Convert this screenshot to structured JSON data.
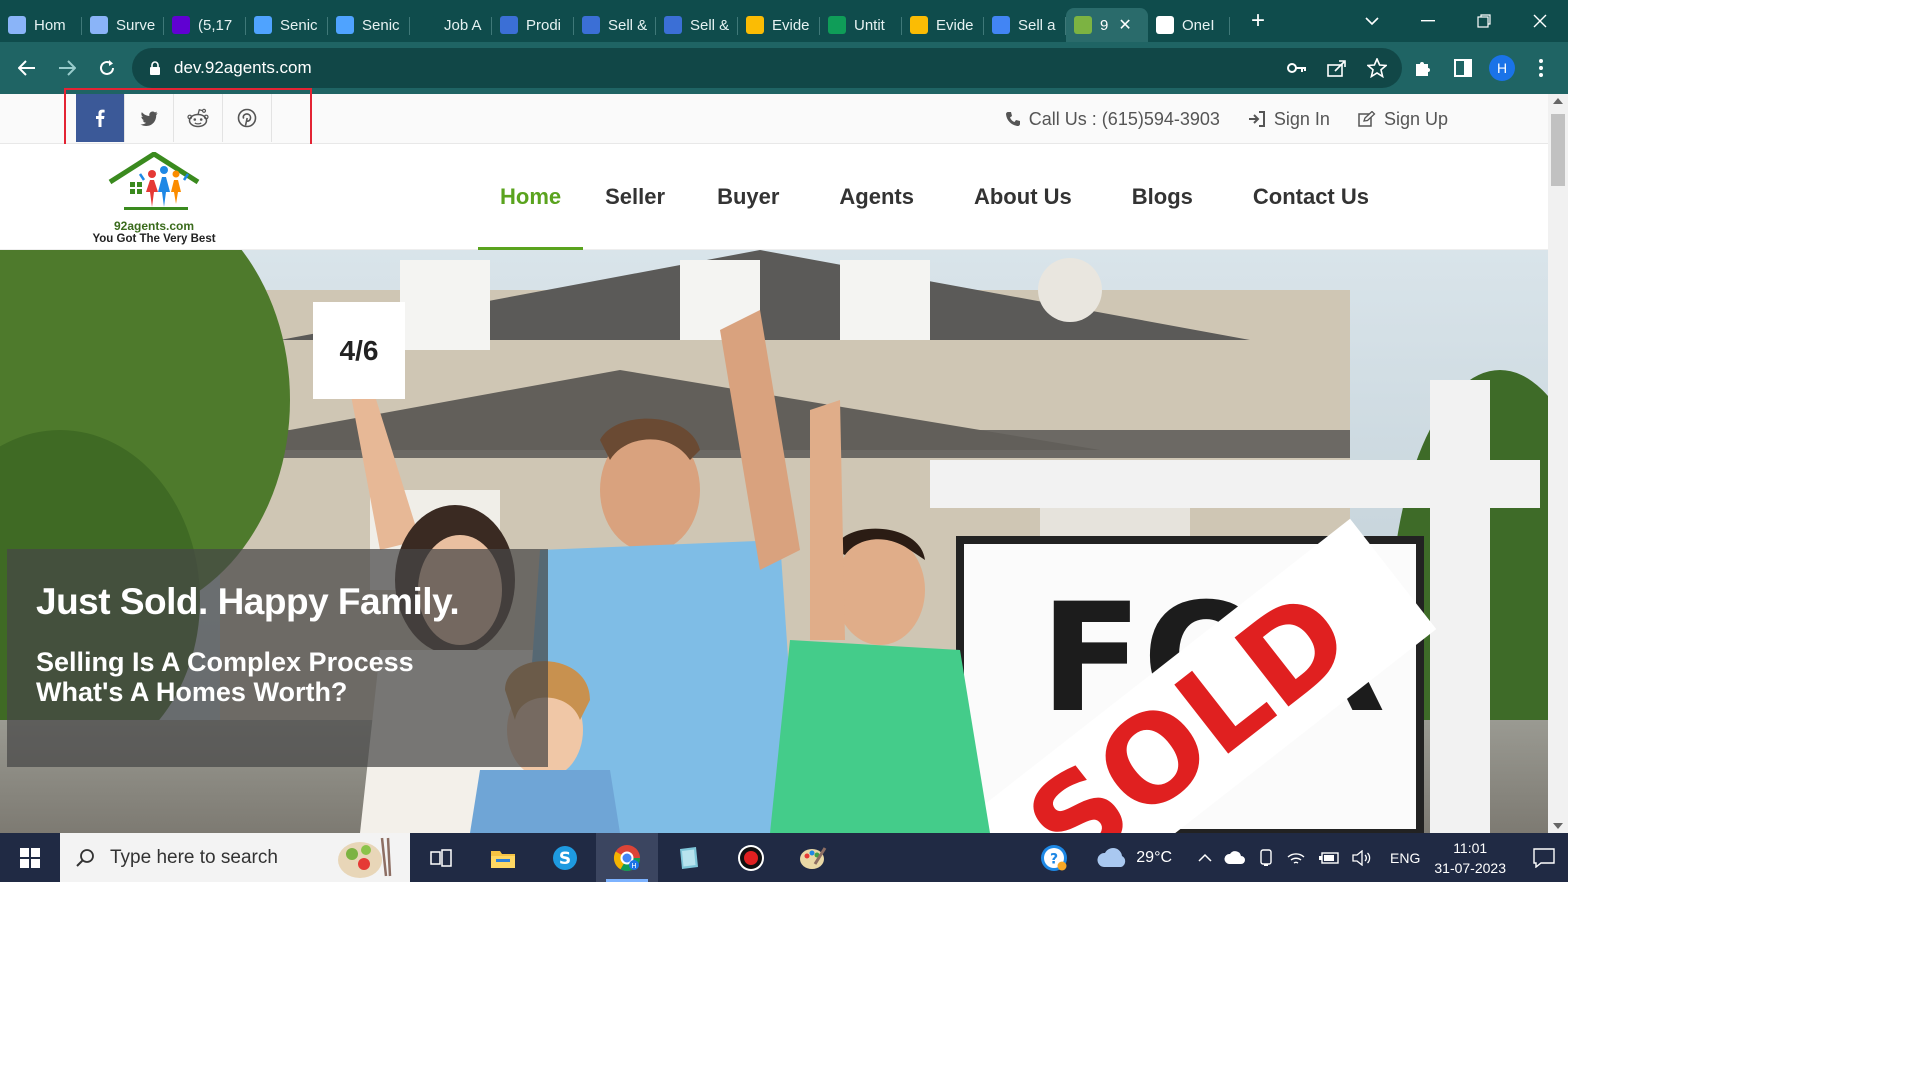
{
  "browser": {
    "tabs": [
      {
        "label": "Hom",
        "icon": "diamond-icon",
        "color": "#8ab4f8"
      },
      {
        "label": "Surve",
        "icon": "diamond-icon",
        "color": "#8ab4f8"
      },
      {
        "label": "(5,17",
        "icon": "mail-icon",
        "color": "#6001d2"
      },
      {
        "label": "Senic",
        "icon": "moon-icon",
        "color": "#4fa3ff"
      },
      {
        "label": "Senic",
        "icon": "moon-icon",
        "color": "#4fa3ff"
      },
      {
        "label": "Job A",
        "icon": "blank-icon",
        "color": "#0f4c4c"
      },
      {
        "label": "Prodi",
        "icon": "feather-icon",
        "color": "#3b6fd6"
      },
      {
        "label": "Sell &",
        "icon": "feather-icon",
        "color": "#3b6fd6"
      },
      {
        "label": "Sell &",
        "icon": "feather-icon",
        "color": "#3b6fd6"
      },
      {
        "label": "Evide",
        "icon": "drive-icon",
        "color": "#fbbc04"
      },
      {
        "label": "Untit",
        "icon": "plus-doc-icon",
        "color": "#0f9d58"
      },
      {
        "label": "Evide",
        "icon": "drive-icon",
        "color": "#fbbc04"
      },
      {
        "label": "Sell a",
        "icon": "docs-icon",
        "color": "#4285f4"
      },
      {
        "label": "9",
        "icon": "92-icon",
        "color": "#7cb342",
        "active": true
      },
      {
        "label": "OneI",
        "icon": "amazon-icon",
        "color": "#ffffff"
      }
    ],
    "url": "dev.92agents.com",
    "profile_initial": "H"
  },
  "topbar": {
    "social": [
      "facebook-icon",
      "twitter-icon",
      "reddit-icon",
      "pinterest-icon"
    ],
    "call_label": "Call Us : (615)594-3903",
    "sign_in": "Sign In",
    "sign_up": "Sign Up"
  },
  "logo": {
    "domain": "92agents.com",
    "tagline": "You Got The Very Best"
  },
  "nav": {
    "items": [
      "Home",
      "Seller",
      "Buyer",
      "Agents",
      "About Us",
      "Blogs",
      "Contact Us"
    ],
    "active": "Home"
  },
  "hero": {
    "counter": "4/6",
    "headline": "Just Sold. Happy Family.",
    "sub_line1": "Selling Is A Complex Process",
    "sub_line2": "What's A Homes Worth?",
    "sign_text": "SOLD",
    "sign_text_bg": "FOR"
  },
  "taskbar": {
    "search_placeholder": "Type here to search",
    "weather": "29°C",
    "language": "ENG",
    "time": "11:01",
    "date": "31-07-2023"
  },
  "colors": {
    "chrome_frame": "#0f4c4c",
    "accent_green": "#5aa31e",
    "facebook_blue": "#3b5998",
    "highlight_red": "#e32434"
  }
}
